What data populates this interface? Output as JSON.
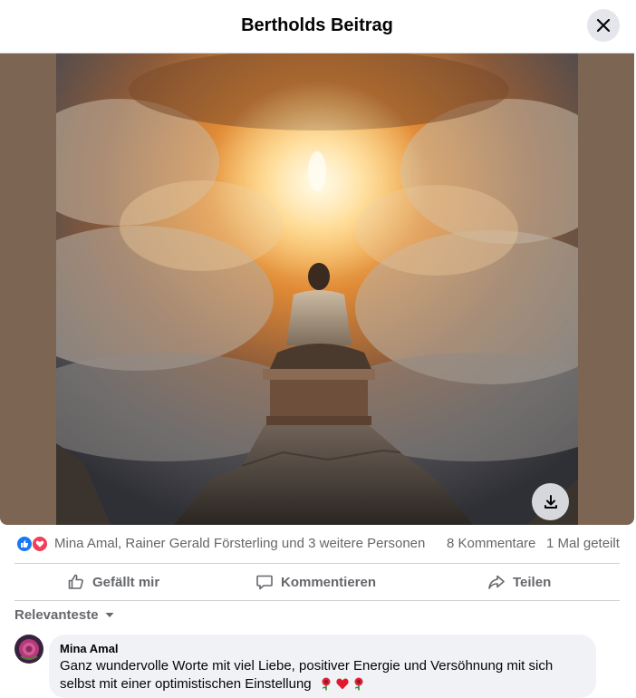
{
  "dialog": {
    "title": "Bertholds Beitrag",
    "close_icon": "close-icon"
  },
  "media": {
    "description_icon": "photo",
    "download_icon": "download-icon"
  },
  "reactions": {
    "icons": [
      "like-reaction-icon",
      "love-reaction-icon"
    ],
    "reactors_text": "Mina Amal, Rainer Gerald Försterling und 3 weitere Personen",
    "comments_text": "8 Kommentare",
    "shares_text": "1 Mal geteilt"
  },
  "actions": {
    "like_label": "Gefällt mir",
    "comment_label": "Kommentieren",
    "share_label": "Teilen"
  },
  "sort": {
    "label": "Relevanteste"
  },
  "comments": [
    {
      "author": "Mina Amal",
      "text": "Ganz wundervolle Worte mit viel Liebe, positiver Energie und Versöhnung mit sich selbst mit einer optimistischen Einstellung",
      "emojis": [
        "rose",
        "heart",
        "rose"
      ]
    }
  ],
  "colors": {
    "accent": "#1877f2",
    "love": "#f33e58",
    "secondary_text": "#65676b",
    "bubble": "#f0f2f5",
    "media_bg": "#7c6553"
  }
}
